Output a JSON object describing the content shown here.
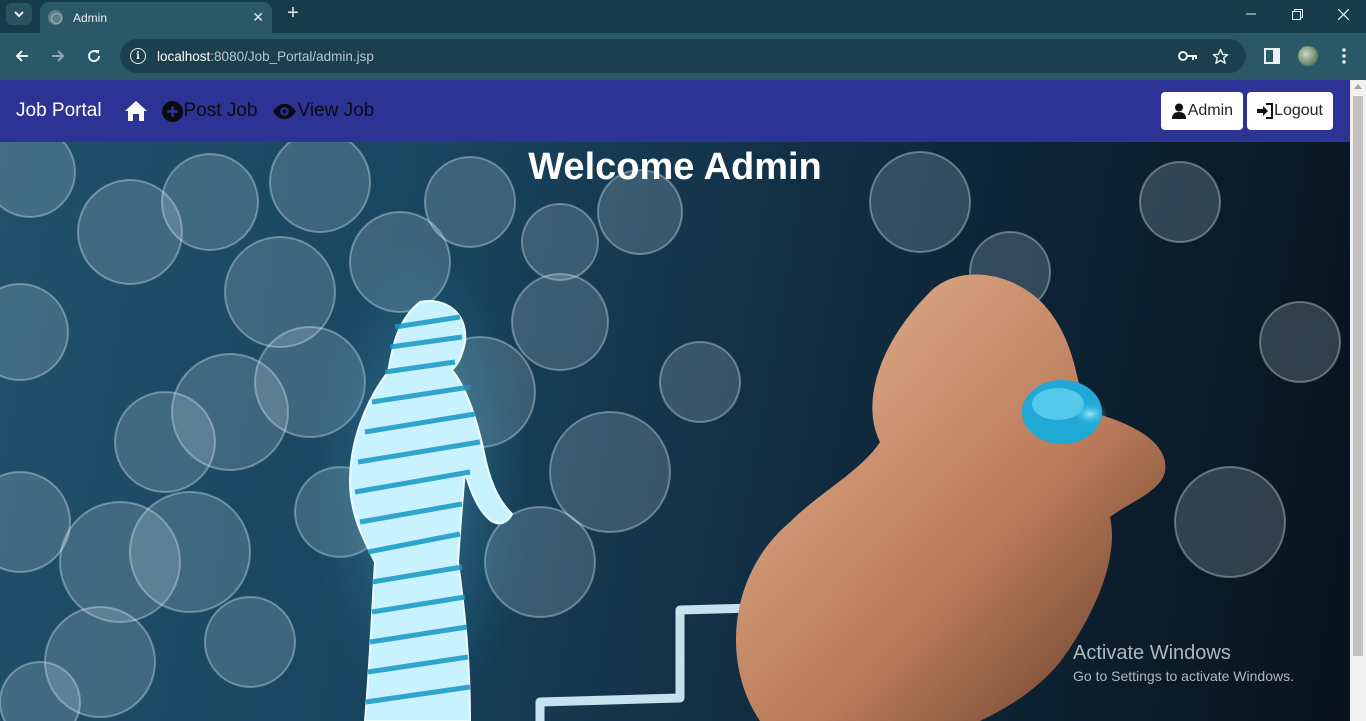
{
  "browser": {
    "tab_title": "Admin",
    "url_host": "localhost",
    "url_rest": ":8080/Job_Portal/admin.jsp"
  },
  "navbar": {
    "brand": "Job Portal",
    "links": [
      {
        "label": "Post Job",
        "icon": "plus-circle-icon"
      },
      {
        "label": "View Job",
        "icon": "eye-icon"
      }
    ],
    "admin_label": "Admin",
    "logout_label": "Logout"
  },
  "hero": {
    "title": "Welcome Admin"
  },
  "watermark": {
    "title": "Activate Windows",
    "subtitle": "Go to Settings to activate Windows."
  },
  "colors": {
    "navbar_bg": "#2d3394",
    "browser_frame": "#2a5866"
  }
}
